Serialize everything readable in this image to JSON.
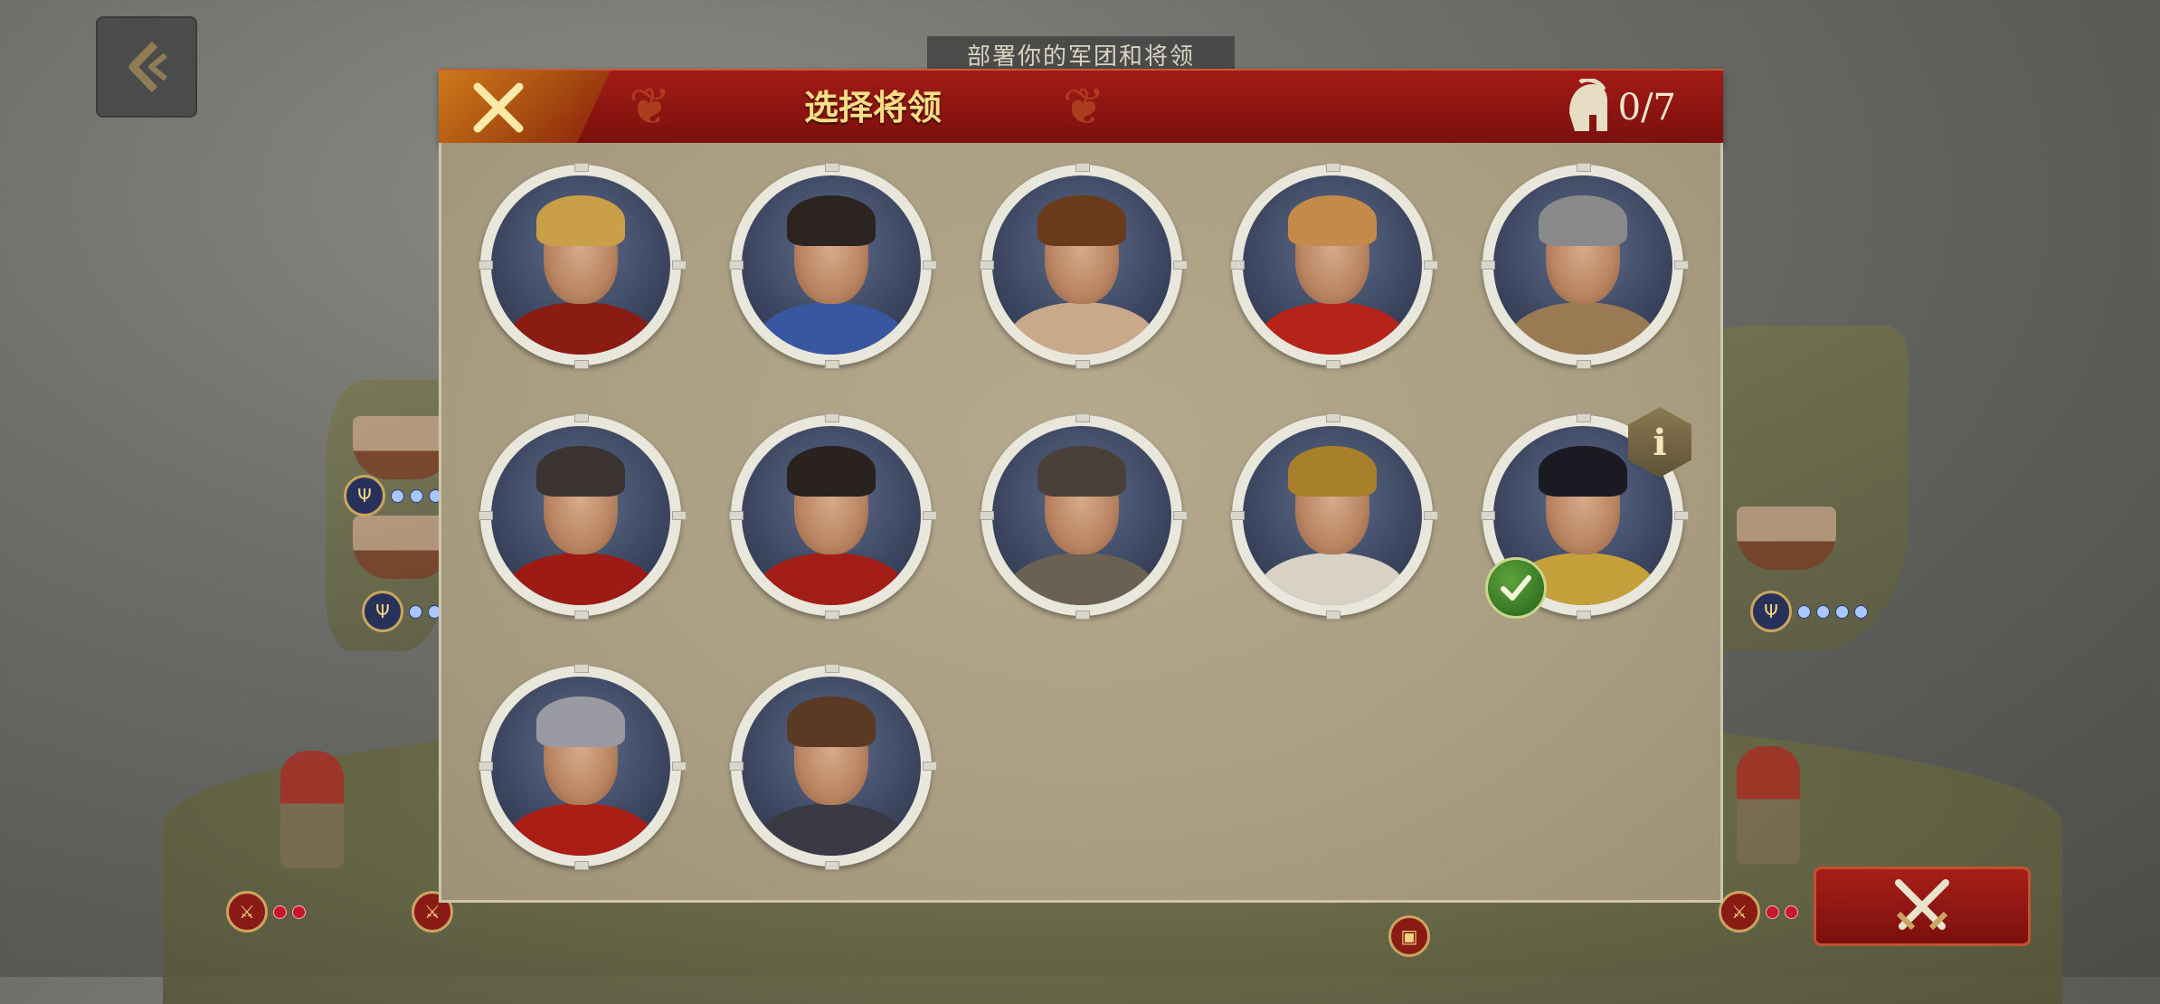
{
  "deploy_banner": "部署你的军团和将领",
  "dialog": {
    "title": "选择将领",
    "counter": "0/7",
    "close_icon": "close-x-icon",
    "counter_icon": "spartan-helmet-icon"
  },
  "generals": [
    {
      "id": 1,
      "desc": "roman-helmet",
      "hair": "#c9a048",
      "armor": "#8a1c14",
      "selected": false
    },
    {
      "id": 2,
      "desc": "dark-hair",
      "hair": "#2b2420",
      "armor": "#3956a0",
      "selected": false
    },
    {
      "id": 3,
      "desc": "young-roman",
      "hair": "#6a3b1a",
      "armor": "#caa88a",
      "selected": false
    },
    {
      "id": 4,
      "desc": "lion-pelt",
      "hair": "#c48a4a",
      "armor": "#b5231a",
      "selected": false
    },
    {
      "id": 5,
      "desc": "winged-helmet",
      "hair": "#8a8a8a",
      "armor": "#9a7a52",
      "selected": false
    },
    {
      "id": 6,
      "desc": "short-hair",
      "hair": "#3b3430",
      "armor": "#9d1b14",
      "selected": false
    },
    {
      "id": 7,
      "desc": "bearded",
      "hair": "#2a221e",
      "armor": "#a21e16",
      "selected": false
    },
    {
      "id": 8,
      "desc": "veteran",
      "hair": "#4a403a",
      "armor": "#6a6054",
      "selected": false
    },
    {
      "id": 9,
      "desc": "headband",
      "hair": "#a87f2a",
      "armor": "#d8d2c6",
      "selected": false
    },
    {
      "id": 10,
      "desc": "egyptian-queen",
      "hair": "#1b1a22",
      "armor": "#c5a03a",
      "selected": true
    },
    {
      "id": 11,
      "desc": "steel-helmet",
      "hair": "#9a9aa2",
      "armor": "#aa1e16",
      "selected": false
    },
    {
      "id": 12,
      "desc": "plain",
      "hair": "#5a3a24",
      "armor": "#3a3a44",
      "selected": false
    }
  ],
  "colors": {
    "header_red": "#8e1510",
    "title_gold": "#f7dd86",
    "panel_bg": "#aea387"
  }
}
